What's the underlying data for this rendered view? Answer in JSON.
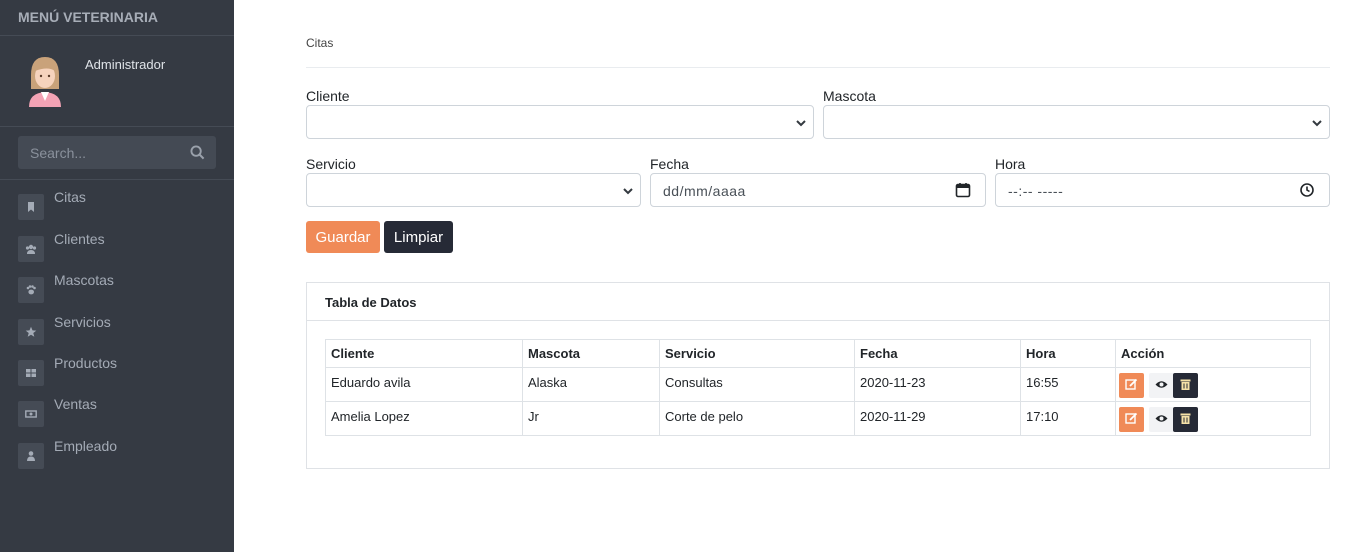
{
  "sidebar": {
    "title": "MENÚ VETERINARIA",
    "user_name": "Administrador",
    "search_placeholder": "Search...",
    "items": [
      {
        "label": "Citas",
        "icon": "bookmark-icon"
      },
      {
        "label": "Clientes",
        "icon": "users-icon"
      },
      {
        "label": "Mascotas",
        "icon": "paw-icon"
      },
      {
        "label": "Servicios",
        "icon": "star-icon"
      },
      {
        "label": "Productos",
        "icon": "grid-icon"
      },
      {
        "label": "Ventas",
        "icon": "money-icon"
      },
      {
        "label": "Empleado",
        "icon": "user-icon"
      }
    ]
  },
  "main": {
    "breadcrumb": "Citas",
    "form": {
      "cliente_label": "Cliente",
      "mascota_label": "Mascota",
      "servicio_label": "Servicio",
      "fecha_label": "Fecha",
      "fecha_placeholder": "dd/mm/aaaa",
      "hora_label": "Hora",
      "hora_placeholder": "--:-- -----",
      "guardar": "Guardar",
      "limpiar": "Limpiar"
    },
    "table": {
      "title": "Tabla de Datos",
      "headers": [
        "Cliente",
        "Mascota",
        "Servicio",
        "Fecha",
        "Hora",
        "Acción"
      ],
      "rows": [
        [
          "Eduardo avila",
          "Alaska",
          "Consultas",
          "2020-11-23",
          "16:55"
        ],
        [
          "Amelia Lopez",
          "Jr",
          "Corte de pelo",
          "2020-11-29",
          "17:10"
        ]
      ]
    }
  },
  "colors": {
    "sidebar_bg": "#353a43",
    "accent_orange": "#f08a57",
    "dark_button": "#262a36"
  }
}
